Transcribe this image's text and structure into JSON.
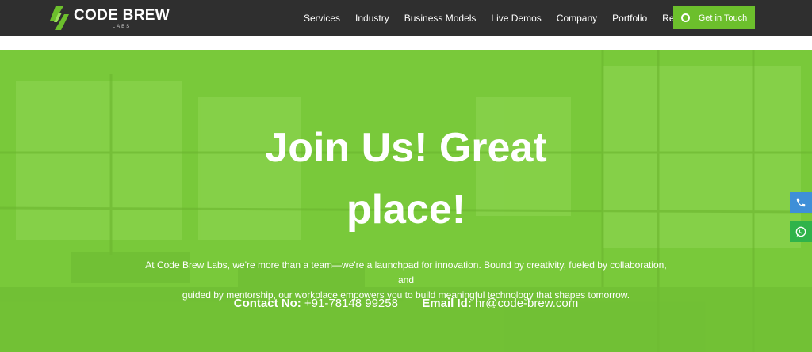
{
  "header": {
    "logo_main": "CODE BREW",
    "logo_sub": "LABS",
    "nav": [
      "Services",
      "Industry",
      "Business Models",
      "Live Demos",
      "Company",
      "Portfolio",
      "Resources"
    ],
    "cta_label": "Get in Touch"
  },
  "hero": {
    "title_line1": "Join Us! Great",
    "title_line2": "place!",
    "description_line1": "At Code Brew Labs, we're more than a team—we're a launchpad for innovation. Bound by creativity, fueled by collaboration, and",
    "description_line2": "guided by mentorship, our workplace empowers you to build meaningful technology that shapes tomorrow.",
    "contact_label": "Contact No:",
    "contact_value": "+91-78148 99258",
    "email_label": "Email Id:",
    "email_value": "hr@code-brew.com"
  },
  "floating": {
    "phone_icon": "phone-icon",
    "whatsapp_icon": "whatsapp-icon"
  },
  "colors": {
    "header_bg": "#2f2f2f",
    "accent": "#6cbf2c",
    "hero_green": "#79c93a",
    "phone_blue": "#3f8fd8",
    "whatsapp_green": "#2fb34a"
  }
}
